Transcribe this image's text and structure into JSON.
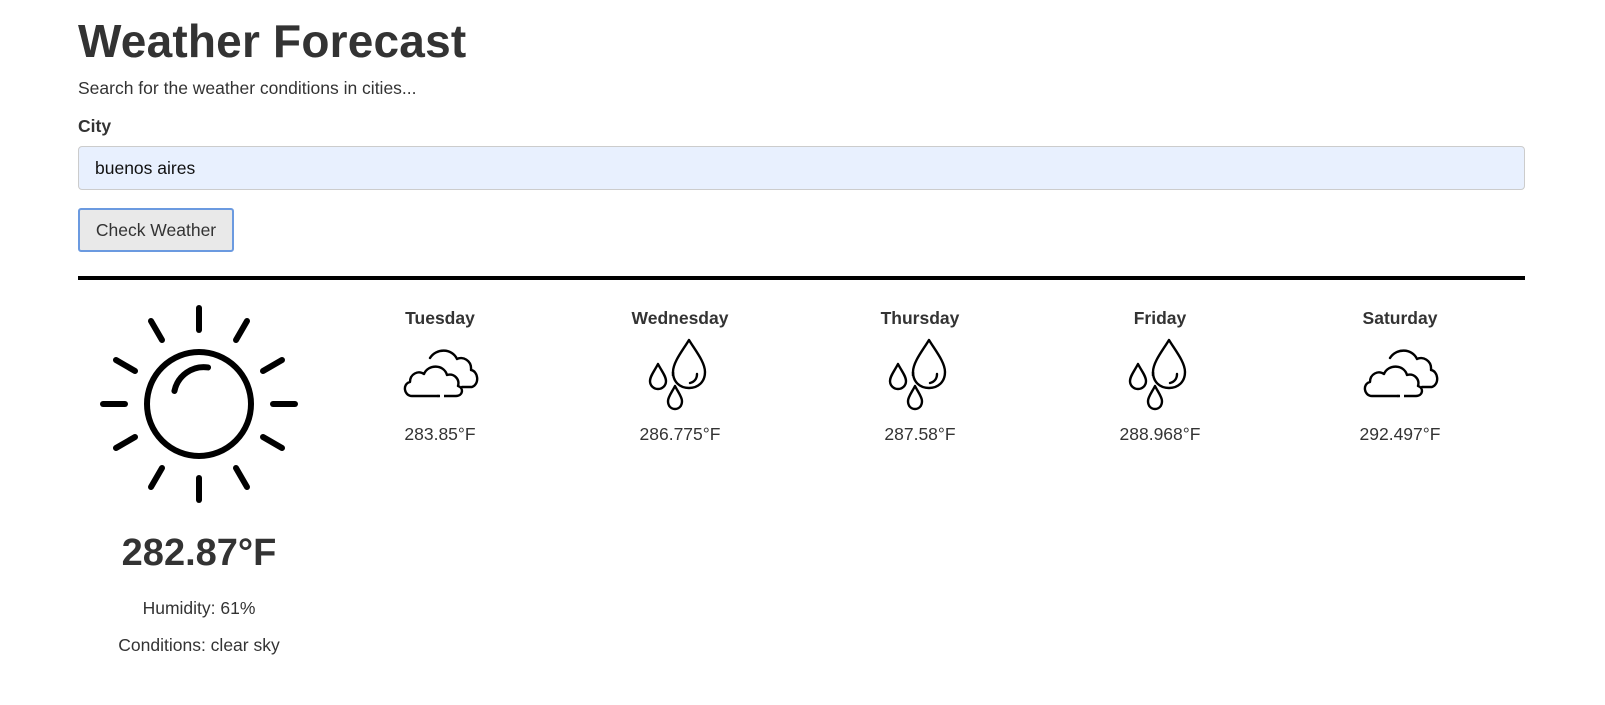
{
  "header": {
    "title": "Weather Forecast",
    "subtitle": "Search for the weather conditions in cities..."
  },
  "search": {
    "label": "City",
    "value": "buenos aires",
    "button_label": "Check Weather"
  },
  "current": {
    "icon": "sun-icon",
    "temperature": "282.87°F",
    "humidity": "Humidity: 61%",
    "conditions": "Conditions: clear sky"
  },
  "forecast": [
    {
      "day": "Tuesday",
      "icon": "cloudy-icon",
      "temperature": "283.85°F"
    },
    {
      "day": "Wednesday",
      "icon": "rain-drops-icon",
      "temperature": "286.775°F"
    },
    {
      "day": "Thursday",
      "icon": "rain-drops-icon",
      "temperature": "287.58°F"
    },
    {
      "day": "Friday",
      "icon": "rain-drops-icon",
      "temperature": "288.968°F"
    },
    {
      "day": "Saturday",
      "icon": "cloudy-icon",
      "temperature": "292.497°F"
    }
  ]
}
